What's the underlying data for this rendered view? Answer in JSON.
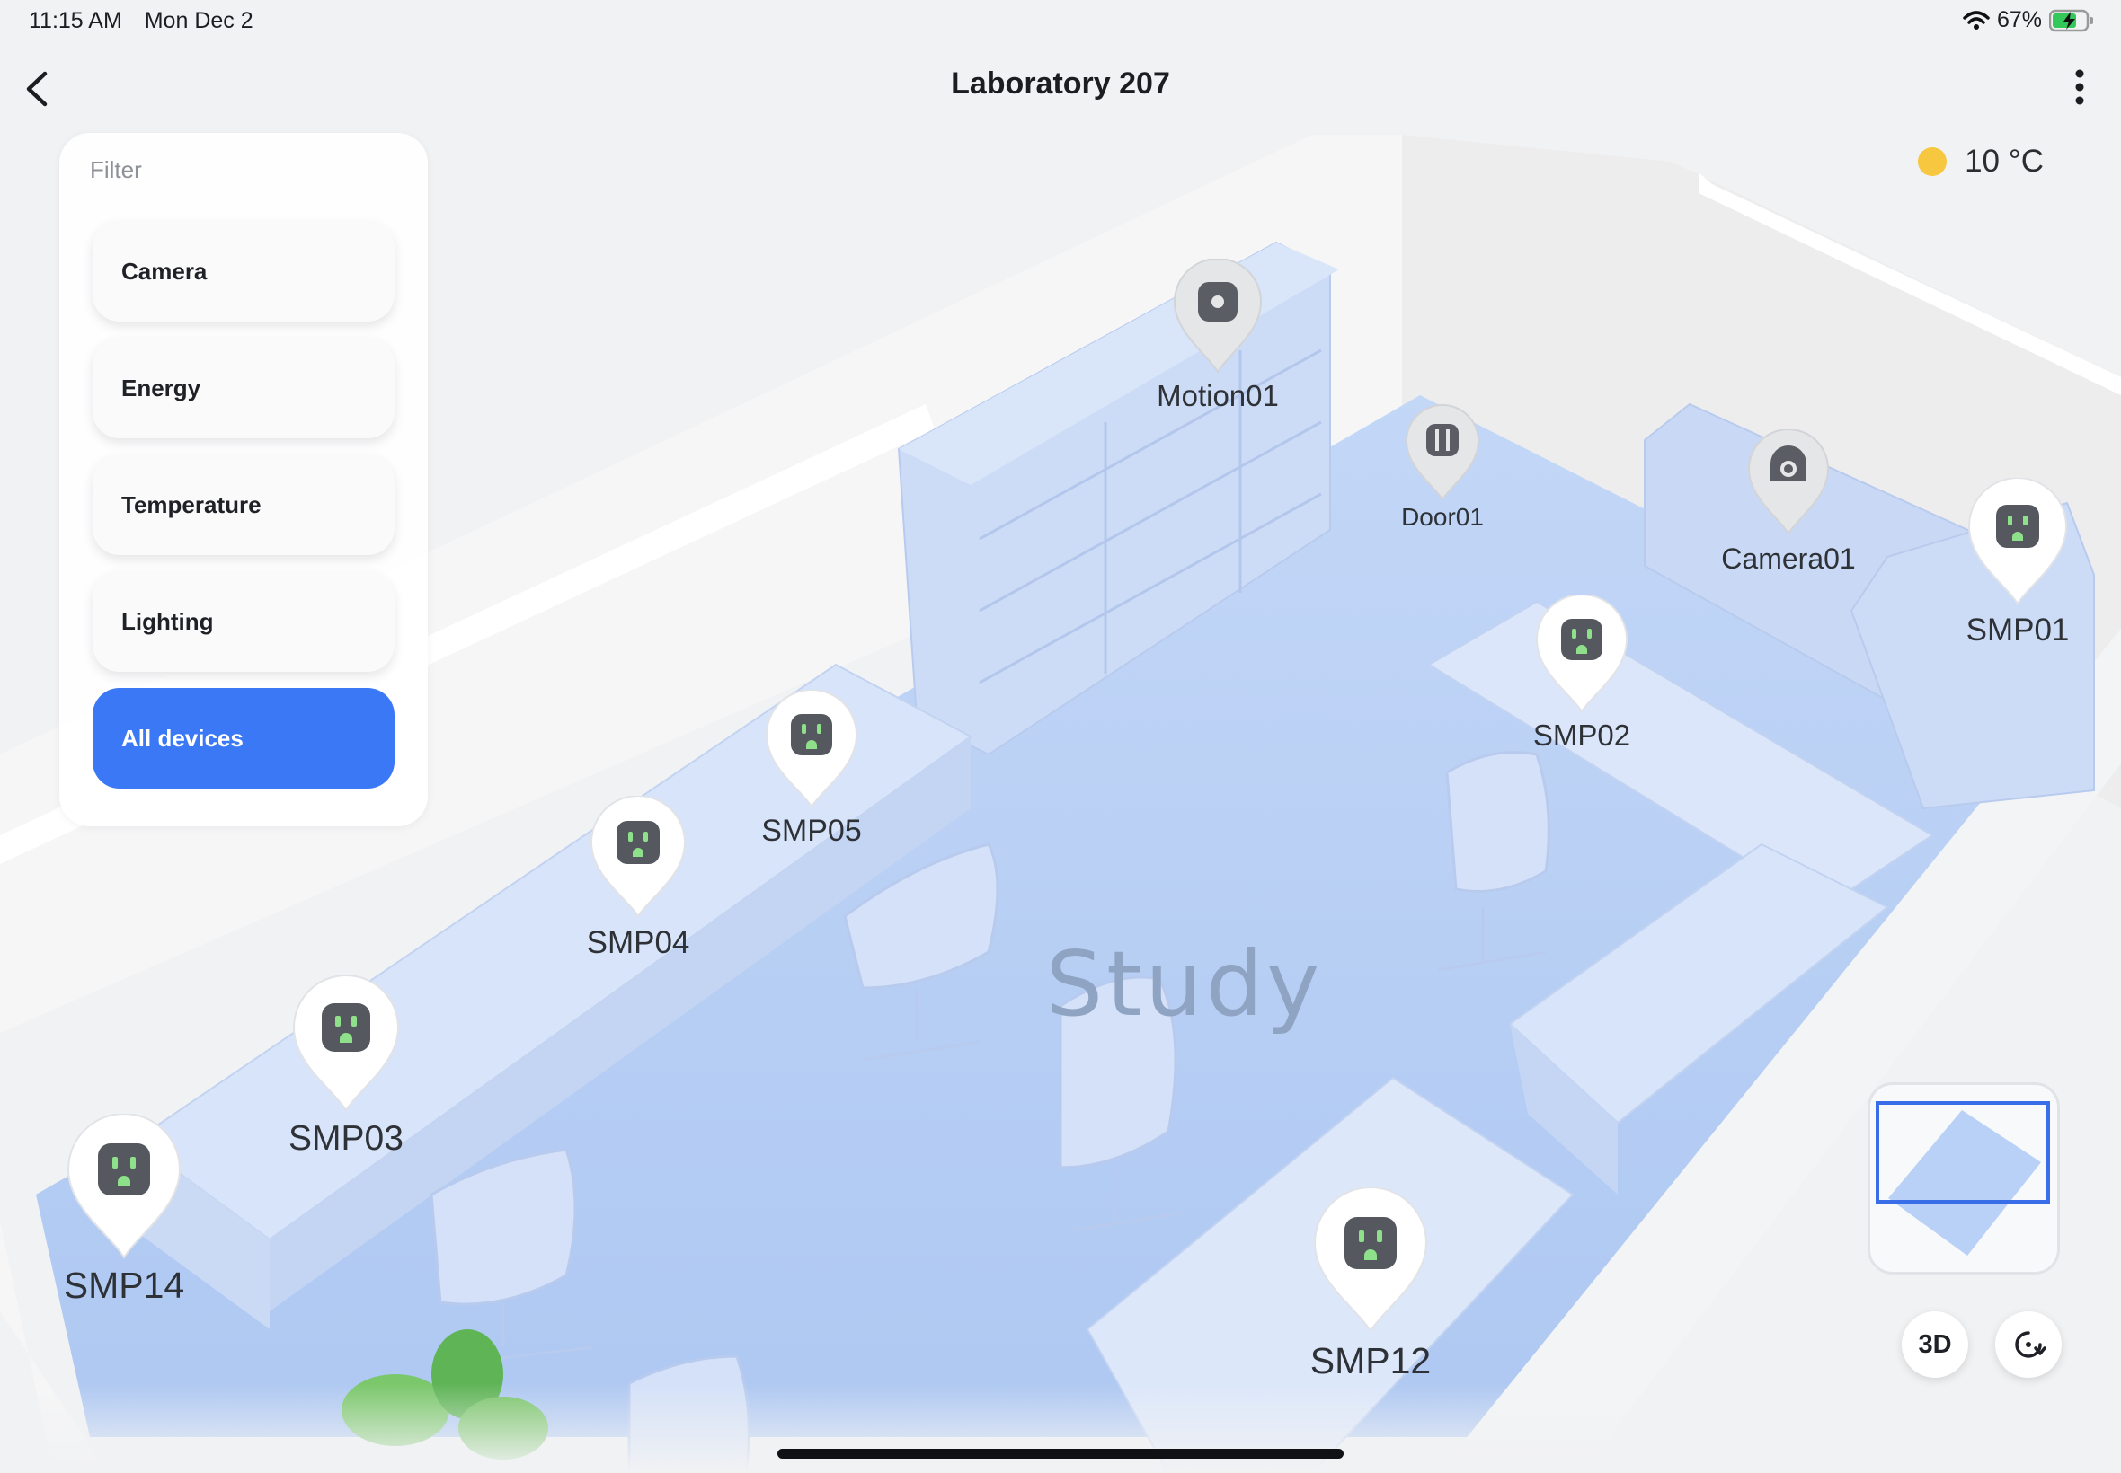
{
  "status_bar": {
    "time": "11:15 AM",
    "date": "Mon Dec 2",
    "battery_percent": "67%",
    "battery_level": 0.67,
    "icons": [
      "wifi-icon",
      "battery-charging-icon"
    ]
  },
  "header": {
    "title": "Laboratory 207",
    "back_icon": "chevron-left-icon",
    "more_icon": "more-vertical-icon"
  },
  "filter": {
    "title": "Filter",
    "options": [
      {
        "label": "Camera",
        "active": false
      },
      {
        "label": "Energy",
        "active": false
      },
      {
        "label": "Temperature",
        "active": false
      },
      {
        "label": "Lighting",
        "active": false
      },
      {
        "label": "All devices",
        "active": true
      }
    ],
    "active_color": "#3a78f5"
  },
  "weather": {
    "temperature": "10 °C",
    "icon": "sun-icon",
    "icon_color": "#f7c73f"
  },
  "room": {
    "label": "Study",
    "floor_color": "#b9d0f5"
  },
  "devices": [
    {
      "label": "Motion01",
      "type": "motion-sensor"
    },
    {
      "label": "Door01",
      "type": "door-sensor"
    },
    {
      "label": "Camera01",
      "type": "camera"
    },
    {
      "label": "SMP01",
      "type": "smart-plug"
    },
    {
      "label": "SMP02",
      "type": "smart-plug"
    },
    {
      "label": "SMP05",
      "type": "smart-plug"
    },
    {
      "label": "SMP04",
      "type": "smart-plug"
    },
    {
      "label": "SMP03",
      "type": "smart-plug"
    },
    {
      "label": "SMP14",
      "type": "smart-plug"
    },
    {
      "label": "SMP12",
      "type": "smart-plug"
    }
  ],
  "controls": {
    "view_mode": "3D",
    "reset_icon": "rotate-reset-icon",
    "minimap_icon": "minimap"
  }
}
